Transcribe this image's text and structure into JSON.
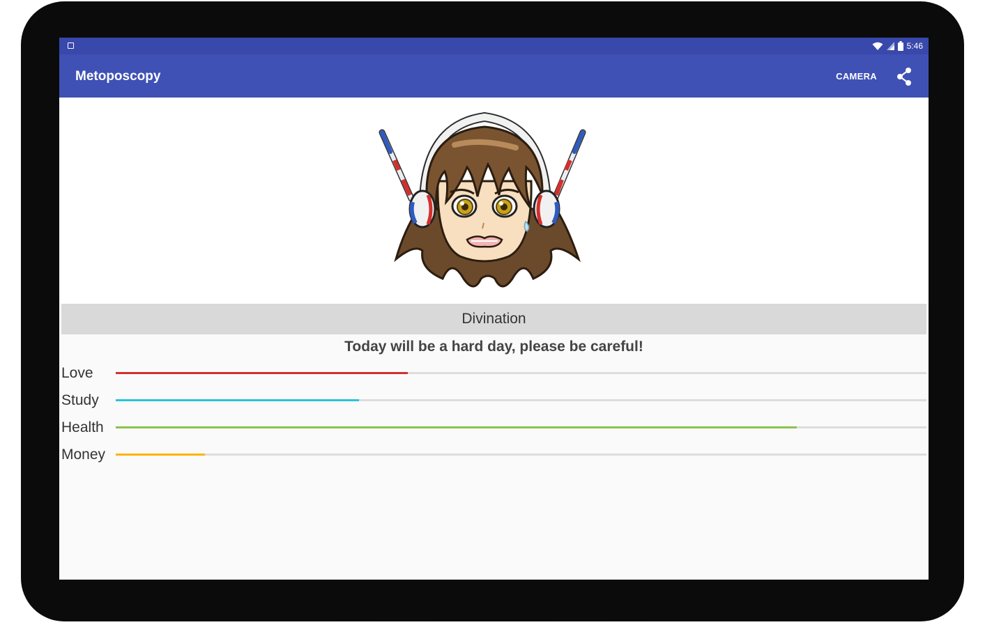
{
  "status_bar": {
    "time": "5:46",
    "icons": [
      "notification-icon",
      "wifi-icon",
      "signal-icon",
      "battery-icon"
    ]
  },
  "app_bar": {
    "title": "Metoposcopy",
    "camera_label": "CAMERA",
    "share_icon": "share-icon"
  },
  "colors": {
    "status_bar": "#3948ab",
    "app_bar": "#3f51b5",
    "love": "#d32f2f",
    "study": "#26c6da",
    "health": "#8bc34a",
    "money": "#ffb300"
  },
  "avatar": {
    "icon": "anime-girl-worried-face-icon"
  },
  "section_header": "Divination",
  "message": "Today will be a hard day, please be careful!",
  "metrics": [
    {
      "label": "Love",
      "value": 0.36,
      "color": "#d32f2f"
    },
    {
      "label": "Study",
      "value": 0.3,
      "color": "#26c6da"
    },
    {
      "label": "Health",
      "value": 0.84,
      "color": "#8bc34a"
    },
    {
      "label": "Money",
      "value": 0.11,
      "color": "#ffb300"
    }
  ]
}
